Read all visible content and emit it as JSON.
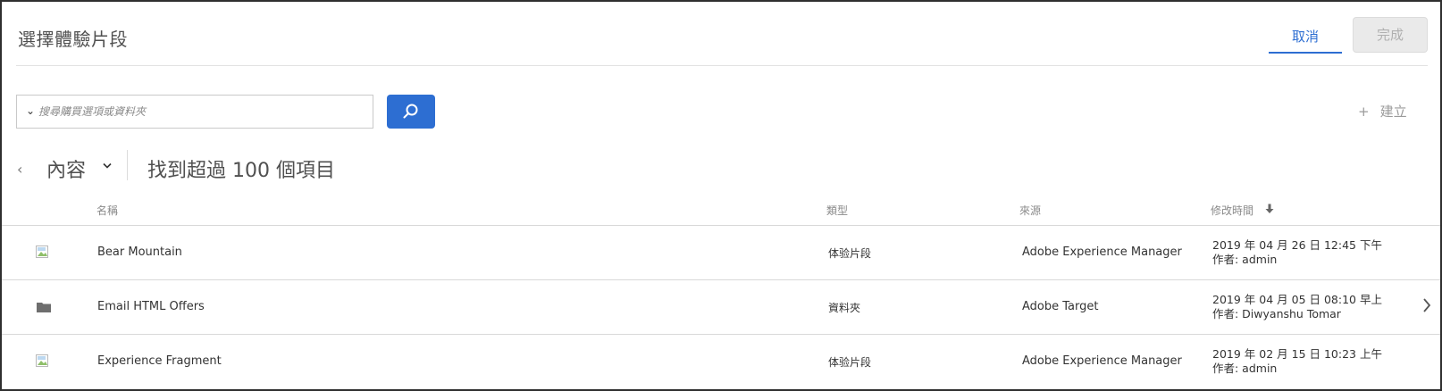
{
  "dialog": {
    "title": "選擇體驗片段",
    "cancel_label": "取消",
    "done_label": "完成"
  },
  "search": {
    "placeholder": "搜尋購買選項或資料夾"
  },
  "toolbar": {
    "create_label": "建立",
    "create_icon": "plus-icon"
  },
  "breadcrumb": {
    "location": "內容",
    "result_count": "找到超過 100 個項目"
  },
  "table": {
    "columns": [
      "名稱",
      "類型",
      "來源",
      "修改時間"
    ],
    "sort_icon": "sort-descending-icon",
    "rows": [
      {
        "icon": "image-placeholder-icon",
        "name": "Bear Mountain",
        "type": "体验片段",
        "source": "Adobe Experience Manager",
        "modified": "2019 年 04 月 26 日 12:45 下午",
        "author": "作者: admin"
      },
      {
        "icon": "folder-icon",
        "name": "Email HTML Offers",
        "type": "資料夾",
        "source": "Adobe Target",
        "modified": "2019 年 04 月 05 日 08:10 早上",
        "author": "作者: Diwyanshu Tomar"
      },
      {
        "icon": "image-placeholder-icon",
        "name": "Experience Fragment",
        "type": "体验片段",
        "source": "Adobe Experience Manager",
        "modified": "2019 年 02 月 15 日 10:23 上午",
        "author": "作者: admin"
      }
    ]
  },
  "colors": {
    "accent": "#2d6ed2",
    "text": "#333333",
    "muted": "#8a8a8a"
  }
}
